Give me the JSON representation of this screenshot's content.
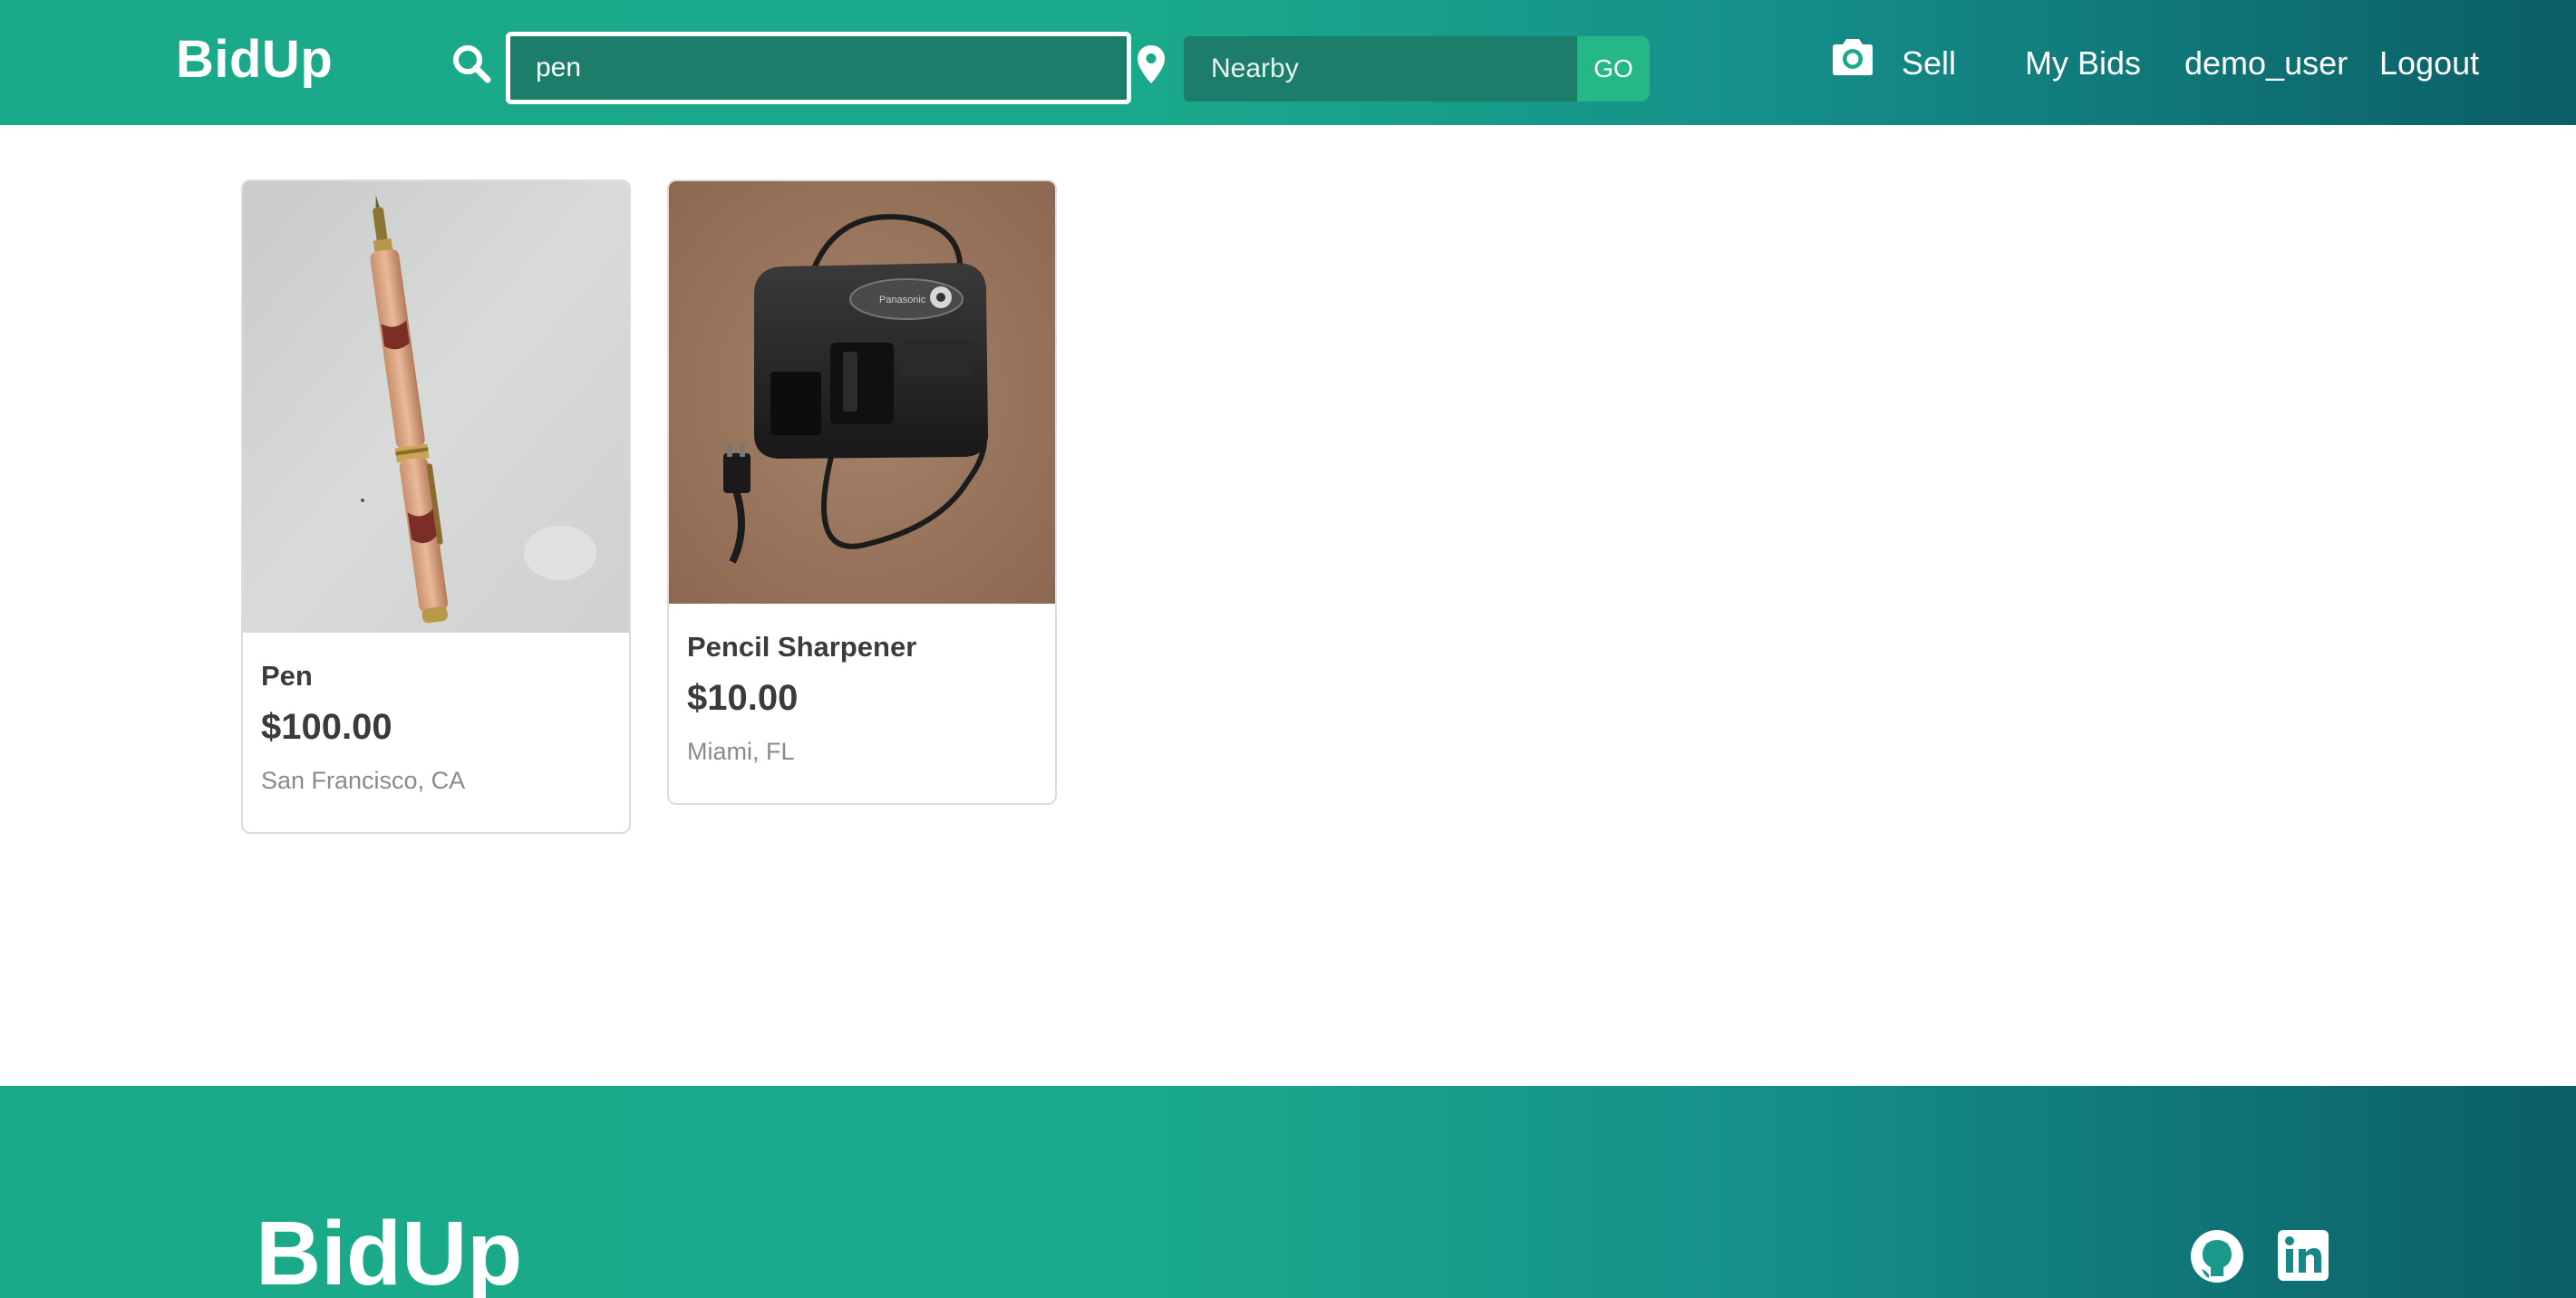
{
  "header": {
    "brand": "BidUp",
    "search": {
      "value": "pen",
      "placeholder": ""
    },
    "location": {
      "value": "",
      "placeholder": "Nearby"
    },
    "go_label": "GO",
    "nav": {
      "sell": "Sell",
      "my_bids": "My Bids",
      "user": "demo_user",
      "logout": "Logout"
    }
  },
  "listings": [
    {
      "title": "Pen",
      "price": "$100.00",
      "location": "San Francisco, CA"
    },
    {
      "title": "Pencil Sharpener",
      "price": "$10.00",
      "location": "Miami, FL"
    }
  ],
  "footer": {
    "brand": "BidUp",
    "icons": [
      "github-icon",
      "linkedin-icon"
    ]
  },
  "colors": {
    "header_gradient_start": "#1aaa8a",
    "header_gradient_end": "#0b5e66",
    "search_bg": "#1c7d6a",
    "go_button": "#26b786",
    "text_dark": "#3b3b3b",
    "text_muted": "#8a8a8a"
  }
}
